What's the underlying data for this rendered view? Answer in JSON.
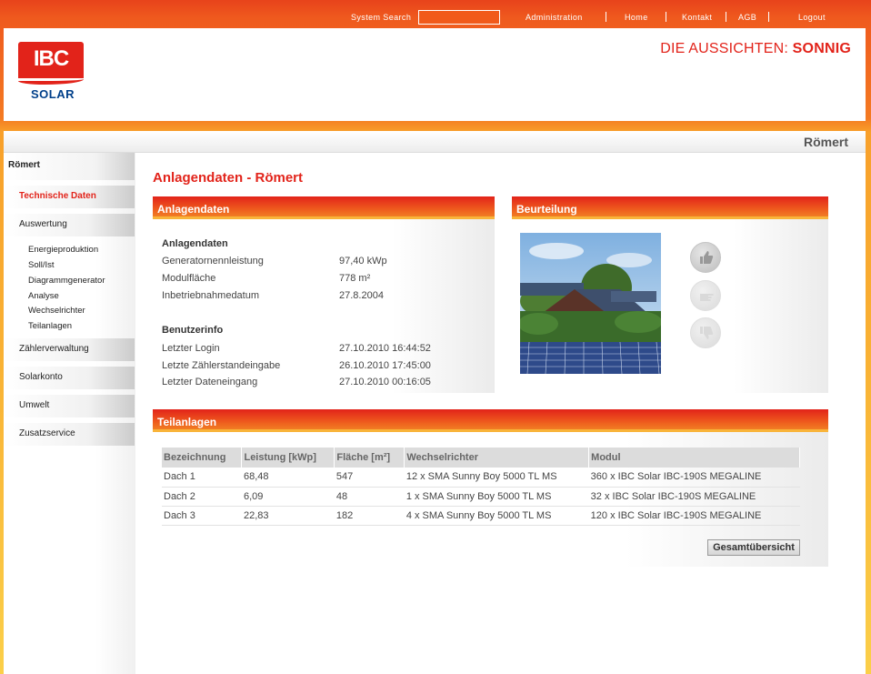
{
  "topnav": {
    "search_label": "System Search",
    "search_value": "",
    "links": [
      "Administration",
      "Home",
      "Kontakt",
      "AGB",
      "Logout"
    ]
  },
  "header": {
    "logo_top": "IBC",
    "logo_bottom": "SOLAR",
    "slogan_prefix": "DIE AUSSICHTEN: ",
    "slogan_bold": "SONNIG"
  },
  "breadcrumb": "Römert",
  "sidebar": {
    "top": "Römert",
    "items": [
      "Technische Daten",
      "Auswertung",
      "Zählerverwaltung",
      "Solarkonto",
      "Umwelt",
      "Zusatzservice"
    ],
    "sub_items": [
      "Energieproduktion",
      "Soll/Ist",
      "Diagrammgenerator",
      "Analyse",
      "Wechselrichter",
      "Teilanlagen"
    ]
  },
  "page_title": "Anlagendaten - Römert",
  "anlagendaten": {
    "panel_title": "Anlagendaten",
    "section1_title": "Anlagendaten",
    "section1": [
      {
        "key": "Generatornennleistung",
        "value": "97,40 kWp"
      },
      {
        "key": "Modulfläche",
        "value": "778 m²"
      },
      {
        "key": "Inbetriebnahmedatum",
        "value": "27.8.2004"
      }
    ],
    "section2_title": "Benutzerinfo",
    "section2": [
      {
        "key": "Letzter Login",
        "value": "27.10.2010 16:44:52"
      },
      {
        "key": "Letzte Zählerstandeingabe",
        "value": "26.10.2010 17:45:00"
      },
      {
        "key": "Letzter Dateneingang",
        "value": "27.10.2010 00:16:05"
      }
    ]
  },
  "beurteilung": {
    "panel_title": "Beurteilung"
  },
  "teilanlagen": {
    "panel_title": "Teilanlagen",
    "columns": [
      "Bezeichnung",
      "Leistung [kWp]",
      "Fläche [m²]",
      "Wechselrichter",
      "Modul"
    ],
    "rows": [
      [
        "Dach 1",
        "68,48",
        "547",
        "12 x SMA Sunny Boy 5000 TL MS",
        "360 x IBC Solar IBC-190S MEGALINE"
      ],
      [
        "Dach 2",
        "6,09",
        "48",
        "1 x SMA Sunny Boy 5000 TL MS",
        "32 x IBC Solar IBC-190S MEGALINE"
      ],
      [
        "Dach 3",
        "22,83",
        "182",
        "4 x SMA Sunny Boy 5000 TL MS",
        "120 x IBC Solar IBC-190S MEGALINE"
      ]
    ],
    "overview_button": "Gesamtübersicht"
  }
}
